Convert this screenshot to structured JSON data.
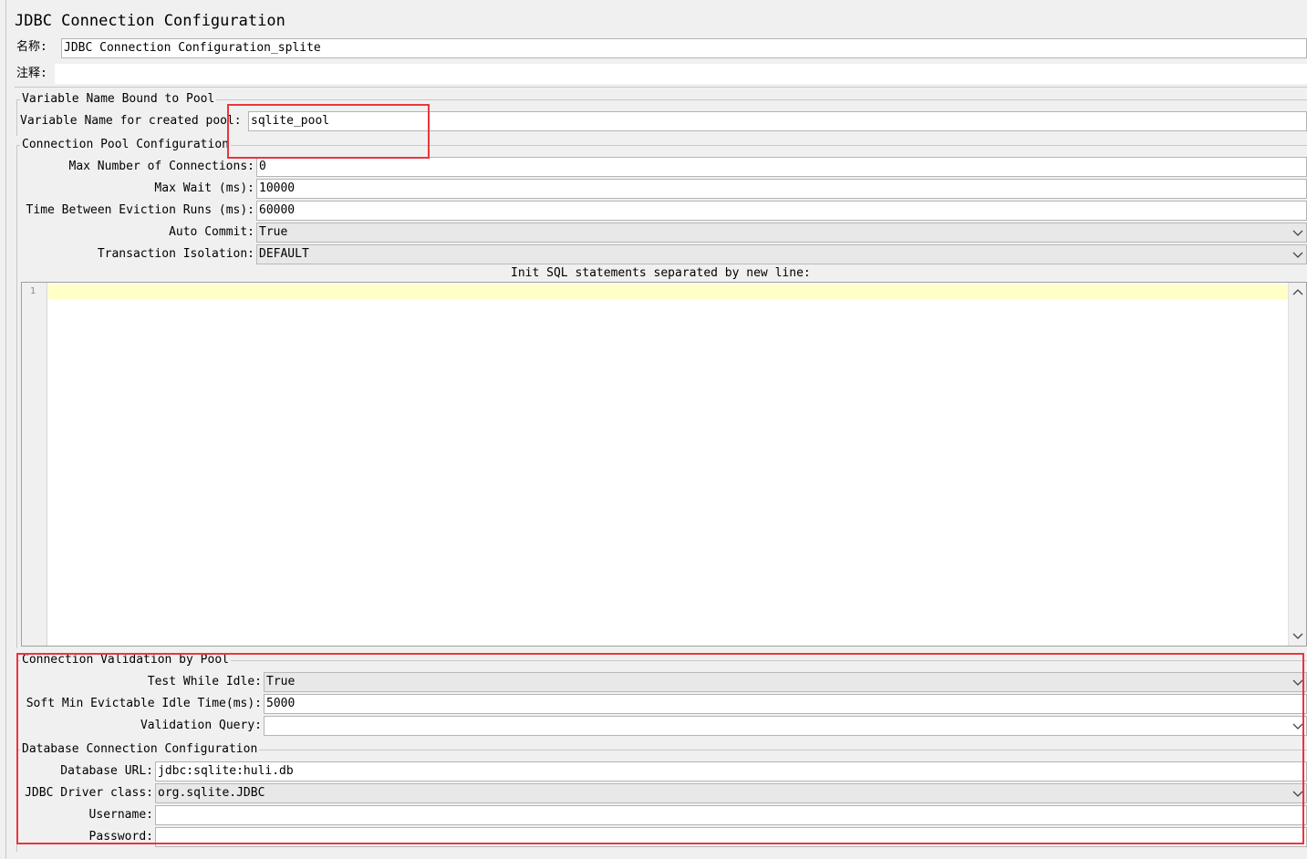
{
  "title": "JDBC Connection Configuration",
  "name_label": "名称:",
  "name_value": "JDBC Connection Configuration_splite",
  "comment_label": "注释:",
  "comment_value": "",
  "pool_section": {
    "title": "Variable Name Bound to Pool",
    "var_label": "Variable Name for created pool:",
    "var_value": "sqlite_pool"
  },
  "conn_pool": {
    "title": "Connection Pool Configuration",
    "max_conn_label": "Max Number of Connections:",
    "max_conn_value": "0",
    "max_wait_label": "Max Wait (ms):",
    "max_wait_value": "10000",
    "eviction_label": "Time Between Eviction Runs (ms):",
    "eviction_value": "60000",
    "auto_commit_label": "Auto Commit:",
    "auto_commit_value": "True",
    "isolation_label": "Transaction Isolation:",
    "isolation_value": "DEFAULT",
    "init_sql_label": "Init SQL statements separated by new line:",
    "line_number": "1",
    "init_sql_value": ""
  },
  "validation": {
    "title": "Connection Validation by Pool",
    "test_idle_label": "Test While Idle:",
    "test_idle_value": "True",
    "soft_min_label": "Soft Min Evictable Idle Time(ms):",
    "soft_min_value": "5000",
    "query_label": "Validation Query:",
    "query_value": ""
  },
  "database": {
    "title": "Database Connection Configuration",
    "url_label": "Database URL:",
    "url_value": "jdbc:sqlite:huli.db",
    "driver_label": "JDBC Driver class:",
    "driver_value": "org.sqlite.JDBC",
    "username_label": "Username:",
    "username_value": "",
    "password_label": "Password:",
    "password_value": ""
  },
  "icons": {
    "dropdown": "chevron-down-icon",
    "scroll_up": "chevron-up-icon",
    "scroll_down": "chevron-down-icon"
  },
  "colors": {
    "highlight_box": "#e8363d",
    "editor_current_line": "#ffffc6",
    "panel_bg": "#f0f0f0"
  }
}
